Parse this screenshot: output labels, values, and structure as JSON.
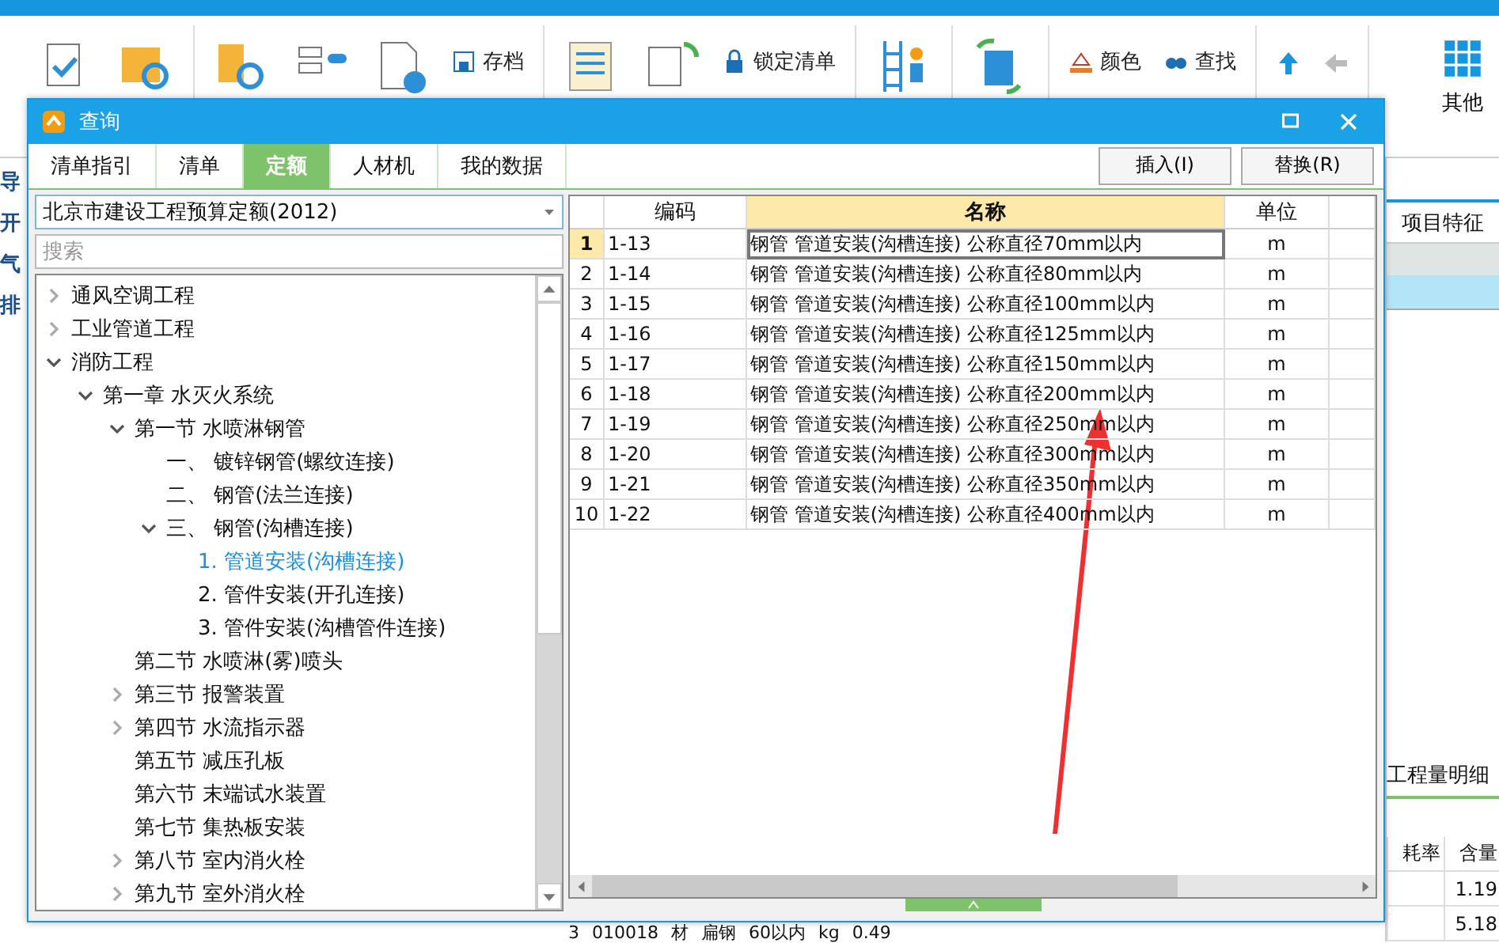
{
  "app": {
    "toolbar": {
      "small_buttons": [
        {
          "label": "存档",
          "kind": "save"
        },
        {
          "label": "锁定清单",
          "kind": "lock"
        },
        {
          "label": "颜色",
          "kind": "color"
        },
        {
          "label": "查找",
          "kind": "find"
        }
      ],
      "more_label": "其他"
    },
    "left_strip": [
      "导",
      "开",
      "气",
      "排"
    ],
    "right_panel": {
      "header": "项目特征",
      "detail_tab": "工程量明细",
      "columns": [
        "耗率",
        "含量"
      ],
      "values": [
        "1.19",
        "5.18"
      ]
    },
    "bottom_row": [
      "3",
      "010018",
      "材",
      "扁钢",
      "60以内",
      "kg",
      "0.49"
    ]
  },
  "dialog": {
    "title": "查询",
    "tabs": [
      {
        "label": "清单指引",
        "selected": false
      },
      {
        "label": "清单",
        "selected": false
      },
      {
        "label": "定额",
        "selected": true
      },
      {
        "label": "人材机",
        "selected": false
      },
      {
        "label": "我的数据",
        "selected": false
      }
    ],
    "buttons": [
      "插入(I)",
      "替换(R)"
    ],
    "library": {
      "value": "北京市建设工程预算定额(2012)"
    },
    "search": {
      "placeholder": "搜索"
    },
    "tree": [
      {
        "label": "通风空调工程",
        "expanded": false,
        "selected": false
      },
      {
        "label": "工业管道工程",
        "expanded": false,
        "selected": false
      },
      {
        "label": "消防工程",
        "expanded": true,
        "selected": false,
        "children": [
          {
            "label": "第一章 水灭火系统",
            "expanded": true,
            "selected": false,
            "children": [
              {
                "label": "第一节 水喷淋钢管",
                "expanded": true,
                "selected": false,
                "children": [
                  {
                    "label": "一、 镀锌钢管(螺纹连接)",
                    "selected": false
                  },
                  {
                    "label": "二、 钢管(法兰连接)",
                    "selected": false
                  },
                  {
                    "label": "三、 钢管(沟槽连接)",
                    "expanded": true,
                    "selected": false,
                    "children": [
                      {
                        "label": "1. 管道安装(沟槽连接)",
                        "selected": true
                      },
                      {
                        "label": "2. 管件安装(开孔连接)",
                        "selected": false
                      },
                      {
                        "label": "3. 管件安装(沟槽管件连接)",
                        "selected": false
                      }
                    ]
                  }
                ]
              },
              {
                "label": "第二节 水喷淋(雾)喷头",
                "selected": false
              },
              {
                "label": "第三节 报警装置",
                "expanded": false,
                "selected": false
              },
              {
                "label": "第四节 水流指示器",
                "expanded": false,
                "selected": false
              },
              {
                "label": "第五节 减压孔板",
                "selected": false
              },
              {
                "label": "第六节 末端试水装置",
                "selected": false
              },
              {
                "label": "第七节 集热板安装",
                "selected": false
              },
              {
                "label": "第八节 室内消火栓",
                "expanded": false,
                "selected": false
              },
              {
                "label": "第九节 室外消火栓",
                "expanded": false,
                "selected": false
              }
            ]
          }
        ]
      }
    ],
    "table": {
      "columns": [
        {
          "label": "编码",
          "selected": false
        },
        {
          "label": "名称",
          "selected": true
        },
        {
          "label": "单位",
          "selected": false
        }
      ],
      "rows": [
        {
          "num": "1",
          "code": "1-13",
          "name": "钢管 管道安装(沟槽连接) 公称直径70mm以内",
          "unit": "m",
          "selected": true
        },
        {
          "num": "2",
          "code": "1-14",
          "name": "钢管 管道安装(沟槽连接) 公称直径80mm以内",
          "unit": "m",
          "selected": false
        },
        {
          "num": "3",
          "code": "1-15",
          "name": "钢管 管道安装(沟槽连接) 公称直径100mm以内",
          "unit": "m",
          "selected": false
        },
        {
          "num": "4",
          "code": "1-16",
          "name": "钢管 管道安装(沟槽连接) 公称直径125mm以内",
          "unit": "m",
          "selected": false
        },
        {
          "num": "5",
          "code": "1-17",
          "name": "钢管 管道安装(沟槽连接) 公称直径150mm以内",
          "unit": "m",
          "selected": false
        },
        {
          "num": "6",
          "code": "1-18",
          "name": "钢管 管道安装(沟槽连接) 公称直径200mm以内",
          "unit": "m",
          "selected": false
        },
        {
          "num": "7",
          "code": "1-19",
          "name": "钢管 管道安装(沟槽连接) 公称直径250mm以内",
          "unit": "m",
          "selected": false
        },
        {
          "num": "8",
          "code": "1-20",
          "name": "钢管 管道安装(沟槽连接) 公称直径300mm以内",
          "unit": "m",
          "selected": false
        },
        {
          "num": "9",
          "code": "1-21",
          "name": "钢管 管道安装(沟槽连接) 公称直径350mm以内",
          "unit": "m",
          "selected": false
        },
        {
          "num": "10",
          "code": "1-22",
          "name": "钢管 管道安装(沟槽连接) 公称直径400mm以内",
          "unit": "m",
          "selected": false
        }
      ]
    }
  }
}
